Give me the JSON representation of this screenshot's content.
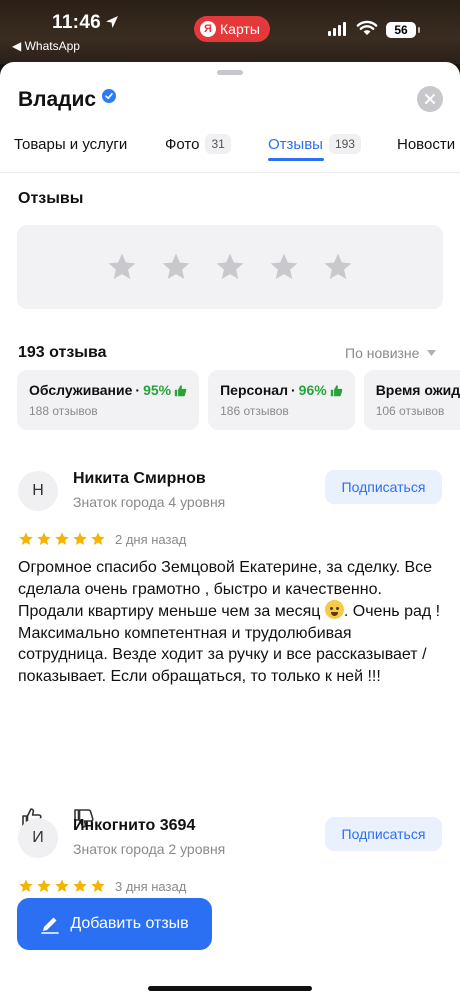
{
  "status_bar": {
    "time": "11:46",
    "back_app": "◀ WhatsApp",
    "app_pill": "Карты",
    "app_pill_logo": "Я",
    "battery": "56"
  },
  "org": {
    "name": "Владис"
  },
  "tabs": [
    {
      "label": "Товары и услуги",
      "count": ""
    },
    {
      "label": "Фото",
      "count": "31"
    },
    {
      "label": "Отзывы",
      "count": "193",
      "active": true
    },
    {
      "label": "Новости",
      "count": ""
    }
  ],
  "reviews_section": {
    "title": "Отзывы",
    "rate_stars": 5,
    "count_label": "193 отзыва",
    "sort_label": "По новизне"
  },
  "aspects": [
    {
      "name": "Обслуживание",
      "sep": " · ",
      "percent": "95%",
      "sub": "188 отзывов"
    },
    {
      "name": "Персонал",
      "sep": " · ",
      "percent": "96%",
      "sub": "186 отзывов"
    },
    {
      "name": "Время ожидания",
      "sep": "",
      "percent": "",
      "sub": "106 отзывов"
    }
  ],
  "reviews": [
    {
      "initial": "Н",
      "author": "Никита Смирнов",
      "level": "Знаток города 4 уровня",
      "subscribe": "Подписаться",
      "rating": 5,
      "date": "2 дня назад",
      "text_1": "Огромное спасибо Земцовой Екатерине, за сделку. Все сделала очень грамотно , быстро и качественно. Продали квартиру меньше чем за месяц ",
      "text_2": ". Очень рад !",
      "text_3": "Максимально компетентная и трудолюбивая сотрудница. Везде ходит за ручку и все рассказывает / показывает. Если обращаться, то только к ней !!!"
    },
    {
      "initial": "И",
      "author": "Инкогнито 3694",
      "level": "Знаток города 2 уровня",
      "subscribe": "Подписаться",
      "rating": 5,
      "date": "3 дня назад"
    }
  ],
  "add_review": "Добавить отзыв",
  "colors": {
    "accent": "#2b6ff3",
    "star": "#f4b400",
    "positive": "#2aa23a",
    "pill": "#e4393b"
  }
}
